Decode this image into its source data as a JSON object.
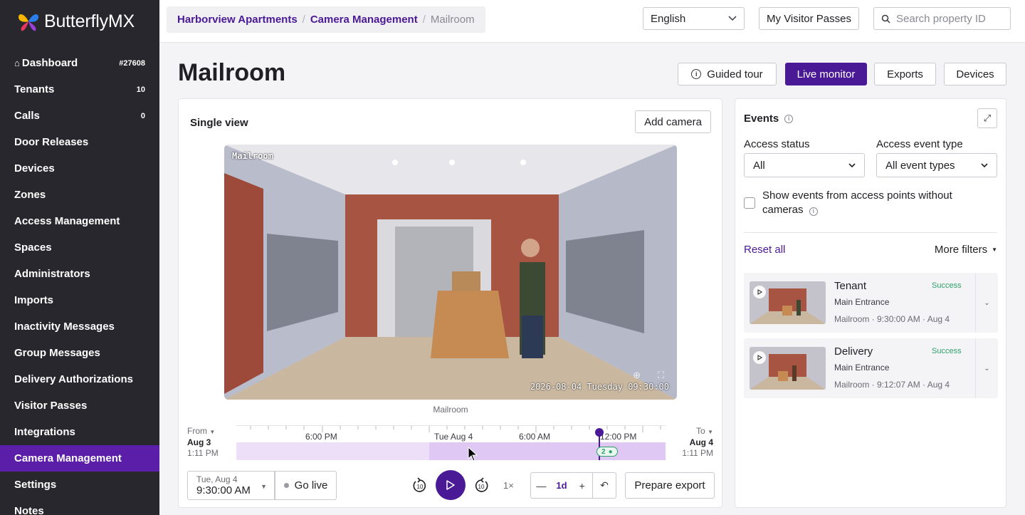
{
  "brand": {
    "name": "ButterflyMX"
  },
  "sidebar": {
    "items": [
      {
        "label": "Dashboard",
        "badge": "#27608"
      },
      {
        "label": "Tenants",
        "badge": "10"
      },
      {
        "label": "Calls",
        "badge": "0"
      },
      {
        "label": "Door Releases",
        "badge": ""
      },
      {
        "label": "Devices",
        "badge": ""
      },
      {
        "label": "Zones",
        "badge": ""
      },
      {
        "label": "Access Management",
        "badge": ""
      },
      {
        "label": "Spaces",
        "badge": ""
      },
      {
        "label": "Administrators",
        "badge": ""
      },
      {
        "label": "Imports",
        "badge": ""
      },
      {
        "label": "Inactivity Messages",
        "badge": ""
      },
      {
        "label": "Group Messages",
        "badge": ""
      },
      {
        "label": "Delivery Authorizations",
        "badge": ""
      },
      {
        "label": "Visitor Passes",
        "badge": ""
      },
      {
        "label": "Integrations",
        "badge": ""
      },
      {
        "label": "Camera Management",
        "badge": "",
        "active": true
      },
      {
        "label": "Settings",
        "badge": ""
      },
      {
        "label": "Notes",
        "badge": ""
      }
    ]
  },
  "topbar": {
    "breadcrumb": [
      "Harborview Apartments",
      "Camera Management",
      "Mailroom"
    ],
    "language": "English",
    "visitor_passes_label": "My Visitor Passes",
    "search_placeholder": "Search property ID"
  },
  "header": {
    "title": "Mailroom",
    "guided_tour": "Guided tour",
    "live_monitor": "Live monitor",
    "exports": "Exports",
    "devices": "Devices"
  },
  "viewer": {
    "title": "Single view",
    "add_camera": "Add camera",
    "camera_name_overlay": "Mailroom",
    "timestamp_overlay": "2026-08-04 Tuesday 09:30:00",
    "caption": "Mailroom"
  },
  "timeline": {
    "from_label": "From",
    "from_date": "Aug 3",
    "from_time": "1:11 PM",
    "to_label": "To",
    "to_date": "Aug 4",
    "to_time": "1:11 PM",
    "ticks": [
      "6:00 PM",
      "Tue Aug 4",
      "6:00 AM",
      "12:00 PM"
    ],
    "event_count": "2"
  },
  "controls": {
    "date_small": "Tue, Aug 4",
    "date_time": "9:30:00 AM",
    "go_live": "Go live",
    "skip_back": "10",
    "skip_forward": "10",
    "speed": "1×",
    "zoom_value": "1d",
    "prepare_export": "Prepare export"
  },
  "events": {
    "title": "Events",
    "access_status_label": "Access status",
    "access_status_value": "All",
    "event_type_label": "Access event type",
    "event_type_value": "All event types",
    "checkbox_label": "Show events from access points without cameras",
    "reset_all": "Reset all",
    "more_filters": "More filters",
    "items": [
      {
        "name": "Tenant",
        "status": "Success",
        "location": "Main Entrance",
        "meta": "Mailroom · 9:30:00 AM · Aug 4"
      },
      {
        "name": "Delivery",
        "status": "Success",
        "location": "Main Entrance",
        "meta": "Mailroom · 9:12:07 AM · Aug 4"
      }
    ]
  },
  "colors": {
    "brand_purple": "#4a1a96",
    "sidebar_bg": "#27272d",
    "sidebar_active": "#5a1ea8",
    "success": "#2fa06b"
  }
}
